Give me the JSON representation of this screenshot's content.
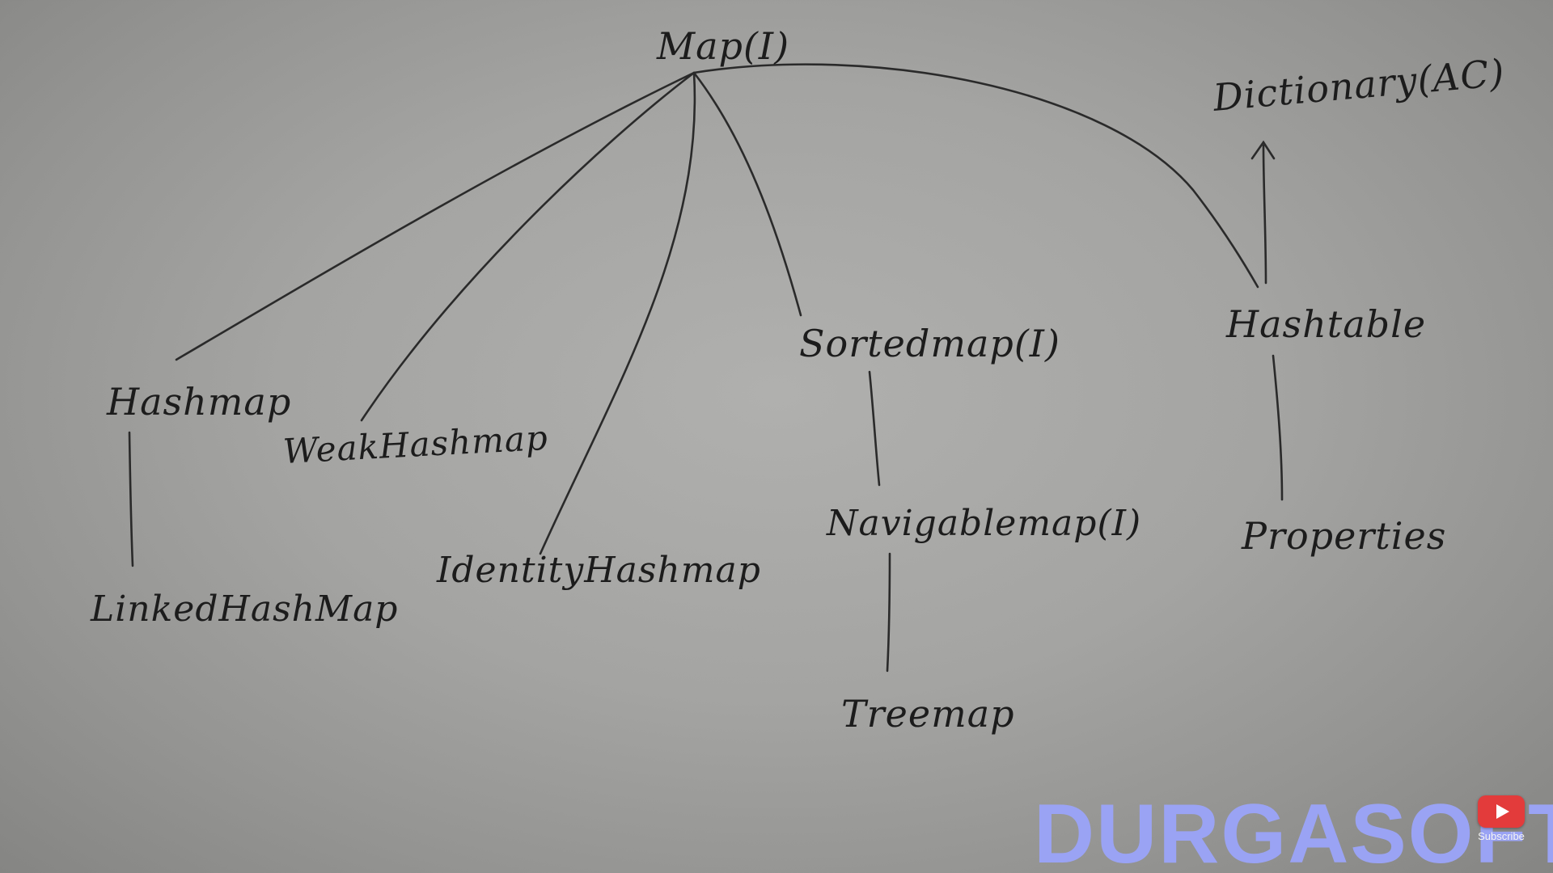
{
  "nodes": {
    "map": "Map(I)",
    "dictionary": "Dictionary(AC)",
    "hashmap": "Hashmap",
    "weak_hashmap": "WeakHashmap",
    "identity_hashmap": "IdentityHashmap",
    "sortedmap": "Sortedmap(I)",
    "hashtable": "Hashtable",
    "linked_hashmap": "LinkedHashMap",
    "navigablemap": "Navigablemap(I)",
    "properties": "Properties",
    "treemap": "Treemap"
  },
  "watermark": {
    "brand": "DURGASOFT"
  },
  "subscribe": {
    "label": "Subscribe",
    "icon": "youtube-play-icon"
  },
  "colors": {
    "board": "#a4a4a2",
    "ink": "#2a2a2a",
    "watermark": "#9aa3f4",
    "subscribe": "#e33b3b"
  }
}
